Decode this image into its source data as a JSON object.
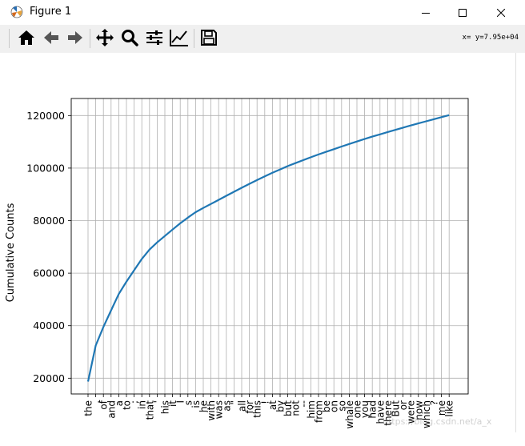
{
  "window": {
    "title": "Figure 1",
    "controls": [
      "minimize",
      "maximize",
      "close"
    ]
  },
  "toolbar": {
    "buttons": [
      {
        "name": "home",
        "icon": "home-icon"
      },
      {
        "name": "back",
        "icon": "arrow-left-icon"
      },
      {
        "name": "forward",
        "icon": "arrow-right-icon"
      },
      {
        "name": "pan",
        "icon": "move-icon"
      },
      {
        "name": "zoom",
        "icon": "magnifier-icon"
      },
      {
        "name": "configure-subplots",
        "icon": "sliders-icon"
      },
      {
        "name": "edit-axis",
        "icon": "line-chart-icon"
      },
      {
        "name": "save",
        "icon": "floppy-icon"
      }
    ],
    "coords": "x= y=7.95e+04"
  },
  "background": {
    "watermark": "https://blog.csdn.net/a_x"
  },
  "chart_data": {
    "type": "line",
    "title": "",
    "xlabel": "",
    "ylabel": "Cumulative Counts",
    "categories": [
      "the",
      ",",
      "of",
      "and",
      "a",
      "to",
      ";",
      "in",
      "that",
      "'",
      "his",
      "it",
      "I",
      "s",
      "is",
      "he",
      "with",
      "was",
      "as",
      "\"",
      "all",
      "for",
      "this",
      "!",
      "at",
      "by",
      "but",
      "not",
      "--",
      "him",
      "from",
      "be",
      "on",
      "so",
      "whale",
      "one",
      "you",
      "had",
      "have",
      "there",
      "But",
      "or",
      "were",
      "now",
      "which",
      "?",
      "me",
      "like"
    ],
    "xtick_labels": [
      "the",
      ",",
      "of",
      "and",
      "a",
      "to",
      ";",
      "in",
      "that",
      "'",
      "his",
      "it",
      "I",
      "s",
      "is",
      "he",
      "with",
      "was",
      "as",
      "\"",
      "all",
      "for",
      "this",
      "!",
      "at",
      "by",
      "but",
      "not",
      "--",
      "him",
      "from",
      "be",
      "on",
      "so",
      "whale",
      "one",
      "you",
      "had",
      "have",
      "there",
      "But",
      "or",
      "were",
      "now",
      "which",
      "?",
      "me",
      "like"
    ],
    "values": [
      18713,
      32433,
      39507,
      45820,
      52048,
      56778,
      61107,
      65399,
      68973,
      71701,
      74159,
      76580,
      78964,
      81159,
      83206,
      84811,
      86345,
      87908,
      89462,
      90996,
      92519,
      94005,
      95429,
      96822,
      98197,
      99499,
      100754,
      101910,
      103025,
      104135,
      105179,
      106204,
      107216,
      108215,
      109180,
      110140,
      111061,
      111973,
      112854,
      113719,
      114563,
      115395,
      116216,
      117021,
      117817,
      118611,
      119394,
      120168
    ],
    "ylim": [
      14000,
      126500
    ],
    "yticks": [
      20000,
      40000,
      60000,
      80000,
      100000,
      120000
    ],
    "ytick_labels": [
      "20000",
      "40000",
      "60000",
      "80000",
      "100000",
      "120000"
    ],
    "grid": true,
    "line_color": "#1f77b4"
  }
}
